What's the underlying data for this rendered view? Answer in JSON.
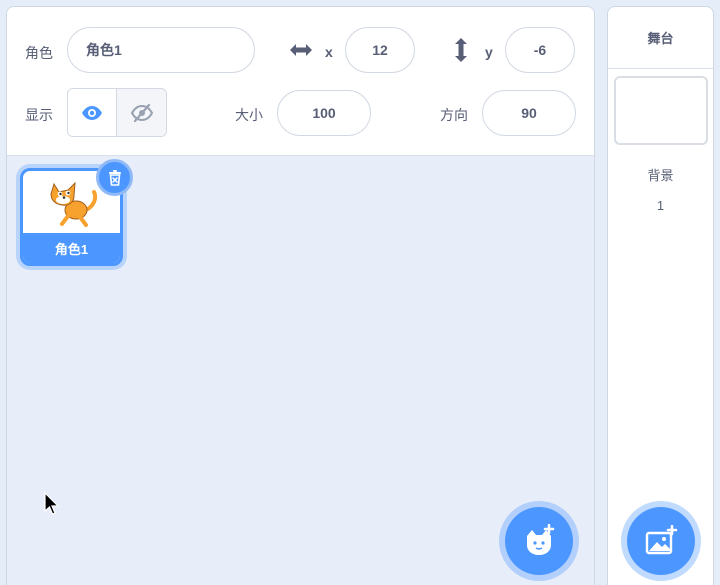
{
  "sprite_info": {
    "sprite_label": "角色",
    "sprite_name": "角色1",
    "x_label": "x",
    "x_value": "12",
    "y_label": "y",
    "y_value": "-6",
    "show_label": "显示",
    "size_label": "大小",
    "size_value": "100",
    "direction_label": "方向",
    "direction_value": "90"
  },
  "sprites": [
    {
      "name": "角色1",
      "selected": true
    }
  ],
  "stage": {
    "header": "舞台",
    "backdrop_label": "背景",
    "backdrop_count": "1"
  },
  "colors": {
    "accent": "#4c97ff",
    "text": "#575e75",
    "pane_bg": "#e8eef9"
  },
  "icons": {
    "x_axis": "horizontal-arrow-icon",
    "y_axis": "vertical-arrow-icon",
    "show": "eye-icon",
    "hide": "eye-slash-icon",
    "delete": "trash-icon",
    "add_sprite": "cat-plus-icon",
    "add_backdrop": "image-plus-icon",
    "pointer": "mouse-cursor-icon"
  }
}
